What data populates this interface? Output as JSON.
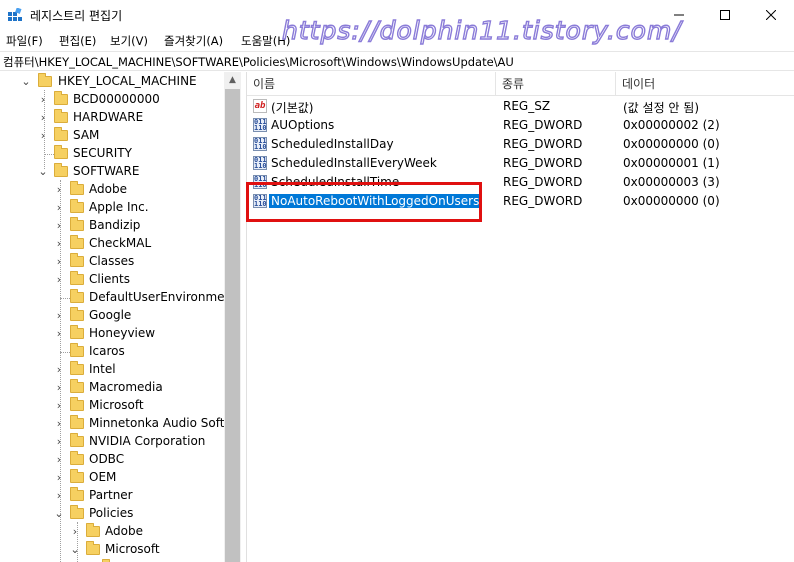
{
  "window": {
    "title": "레지스트리 편집기",
    "minimize_icon": "minimize-icon",
    "maximize_icon": "maximize-icon",
    "close_icon": "close-icon"
  },
  "watermark": "https://dolphin11.tistory.com/",
  "menu": [
    "파일(F)",
    "편집(E)",
    "보기(V)",
    "즐겨찾기(A)",
    "도움말(H)"
  ],
  "address": "컴퓨터\\HKEY_LOCAL_MACHINE\\SOFTWARE\\Policies\\Microsoft\\Windows\\WindowsUpdate\\AU",
  "tree": {
    "root": "HKEY_LOCAL_MACHINE",
    "hklm_children": [
      "BCD00000000",
      "HARDWARE",
      "SAM",
      "SECURITY",
      "SOFTWARE"
    ],
    "software_children": [
      "Adobe",
      "Apple Inc.",
      "Bandizip",
      "CheckMAL",
      "Classes",
      "Clients",
      "DefaultUserEnvironment",
      "Google",
      "Honeyview",
      "Icaros",
      "Intel",
      "Macromedia",
      "Microsoft",
      "Minnetonka Audio Softw",
      "NVIDIA Corporation",
      "ODBC",
      "OEM",
      "Partner",
      "Policies"
    ],
    "policies_children": [
      "Adobe",
      "Microsoft"
    ]
  },
  "list": {
    "columns": [
      "이름",
      "종류",
      "데이터"
    ],
    "rows": [
      {
        "name": "(기본값)",
        "type": "REG_SZ",
        "data": "(값 설정 안 됨)",
        "icon": "string-value-icon"
      },
      {
        "name": "AUOptions",
        "type": "REG_DWORD",
        "data": "0x00000002 (2)",
        "icon": "dword-value-icon"
      },
      {
        "name": "ScheduledInstallDay",
        "type": "REG_DWORD",
        "data": "0x00000000 (0)",
        "icon": "dword-value-icon"
      },
      {
        "name": "ScheduledInstallEveryWeek",
        "type": "REG_DWORD",
        "data": "0x00000001 (1)",
        "icon": "dword-value-icon"
      },
      {
        "name": "ScheduledInstallTime",
        "type": "REG_DWORD",
        "data": "0x00000003 (3)",
        "icon": "dword-value-icon"
      },
      {
        "name": "NoAutoRebootWithLoggedOnUsers",
        "type": "REG_DWORD",
        "data": "0x00000000 (0)",
        "icon": "dword-value-icon"
      }
    ]
  },
  "colors": {
    "selection": "#0078d7",
    "highlight_annotation": "#e01010",
    "folder": "#f6d061"
  }
}
